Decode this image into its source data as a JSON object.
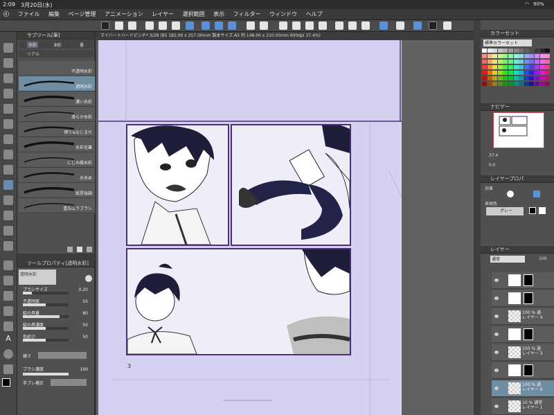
{
  "status": {
    "time": "2:09",
    "date": "3月20日(水)",
    "battery": "90%"
  },
  "menu": [
    "ファイル",
    "編集",
    "ページ管理",
    "アニメーション",
    "レイヤー",
    "選択範囲",
    "表示",
    "フィルター",
    "ウィンドウ",
    "ヘルプ"
  ],
  "subtool": {
    "title": "サブツール[筆]",
    "tabs": [
      "水彩",
      "油彩",
      "墨"
    ],
    "group2": "リアル",
    "brushes": [
      "不透明水彩",
      "透明水彩",
      "濃い水彩",
      "滑らか水彩",
      "擦り&なじませ",
      "水彩毛筆",
      "にじみ縁水彩",
      "水多め",
      "紙質強調",
      "重ねムラブラシ"
    ],
    "selected_index": 1
  },
  "toolprop": {
    "title": "ツールプロパティ[透明水彩]",
    "preset": "透明水彩",
    "props": [
      {
        "label": "ブラシサイズ",
        "value": "0.20",
        "fill": 0.2
      },
      {
        "label": "不透明度",
        "value": "50",
        "fill": 0.5
      },
      {
        "label": "絵の具量",
        "value": "80",
        "fill": 0.8
      },
      {
        "label": "絵の具濃度",
        "value": "50",
        "fill": 0.5
      },
      {
        "label": "色延び",
        "value": "50",
        "fill": 0.5
      }
    ],
    "hardness_label": "硬さ",
    "density_label": "ブラシ濃度",
    "density_value": "100",
    "stab_label": "手ブレ補正"
  },
  "canvas": {
    "tab_title": "マイハートハードピンチ* 3/28 (B5 182.00 x 257.00mm 製本サイズ:A5 判 148.00 x 210.00mm 600dpi 37.4%)",
    "page_number": "3"
  },
  "right": {
    "color_set_title": "カラーセット",
    "color_set_name": "標準カラーセット",
    "navigator_title": "ナビゲー",
    "zoom": "37.4",
    "rotate": "0.0",
    "layer_prop_title": "レイヤープロパ",
    "effect_label": "効果",
    "expr_color_label": "表現色",
    "expr_color_value": "グレー",
    "layer_title": "レイヤー",
    "blend": "通常",
    "opacity": "100",
    "layers": [
      {
        "name": "",
        "pct": "",
        "kind": "folder"
      },
      {
        "name": "",
        "pct": "",
        "kind": "folder"
      },
      {
        "name": "レイヤー 4",
        "pct": "100 % 通",
        "kind": "layer"
      },
      {
        "name": "",
        "pct": "",
        "kind": "folder"
      },
      {
        "name": "レイヤー 3",
        "pct": "100 % 通",
        "kind": "layer"
      },
      {
        "name": "",
        "pct": "",
        "kind": "folder"
      },
      {
        "name": "レイヤー 6",
        "pct": "100 % 通",
        "kind": "layer"
      },
      {
        "name": "レイヤー 1",
        "pct": "10 % 通常",
        "kind": "layer"
      }
    ]
  },
  "colors": {
    "accent": "#6f8ea4",
    "panel_border": "#4b2d7a",
    "page": "#d4d2f0"
  }
}
